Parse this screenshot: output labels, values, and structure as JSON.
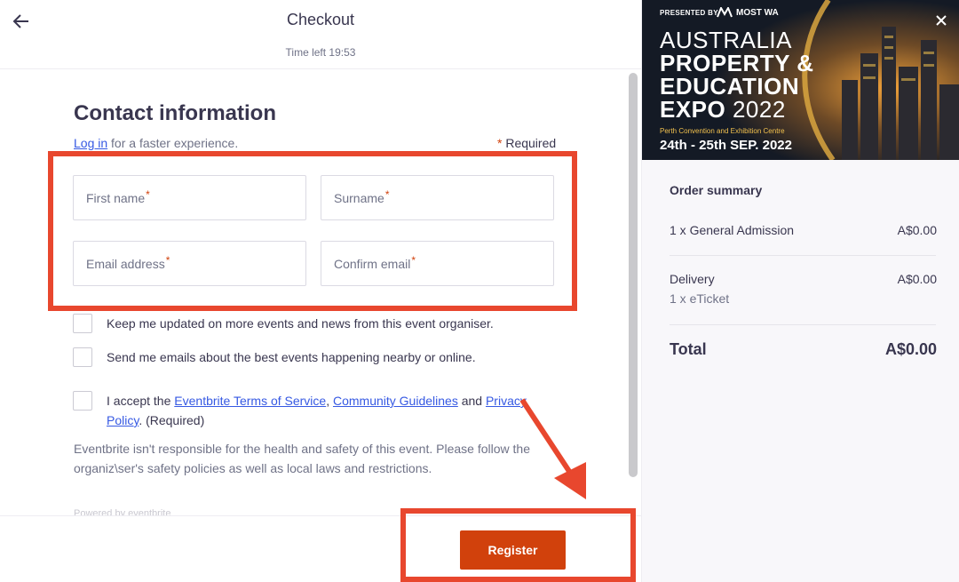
{
  "header": {
    "title": "Checkout",
    "timer": "Time left 19:53"
  },
  "contact": {
    "section_title": "Contact information",
    "login_link": "Log in",
    "login_suffix": " for a faster experience.",
    "required_marker": "*",
    "required_text": " Required",
    "fields": {
      "first_name": "First name",
      "surname": "Surname",
      "email": "Email address",
      "confirm_email": "Confirm email"
    }
  },
  "checkboxes": {
    "organiser_updates": "Keep me updated on more events and news from this event organiser.",
    "best_events": "Send me emails about the best events happening nearby or online.",
    "terms_prefix": "I accept the ",
    "terms_link": "Eventbrite Terms of Service",
    "terms_sep": ", ",
    "guidelines_link": "Community Guidelines",
    "terms_and": " and ",
    "privacy_link_1": "Privacy",
    "privacy_link_2": "Policy",
    "terms_suffix": ". (Required)"
  },
  "disclaimer": "Eventbrite isn't responsible for the health and safety of this event. Please follow the organiz\\ser's safety policies as well as local laws and restrictions.",
  "powered_by": "Powered by eventbrite",
  "register_label": "Register",
  "banner": {
    "presented_by": "PRESENTED BY",
    "brand": "MOST WA",
    "line1": "AUSTRALIA",
    "line2": "PROPERTY &",
    "line3": "EDUCATION",
    "line4_bold": "EXPO",
    "line4_year": " 2022",
    "venue": "Perth Convention and Exhibition Centre",
    "dates": "24th - 25th SEP. 2022"
  },
  "summary": {
    "title": "Order summary",
    "ticket_label": "1 x General Admission",
    "ticket_amount": "A$0.00",
    "delivery_label": "Delivery",
    "delivery_amount": "A$0.00",
    "delivery_sub": "1 x eTicket",
    "total_label": "Total",
    "total_amount": "A$0.00"
  },
  "colors": {
    "accent": "#d1410c",
    "highlight": "#e8472e",
    "link": "#3659e3"
  }
}
